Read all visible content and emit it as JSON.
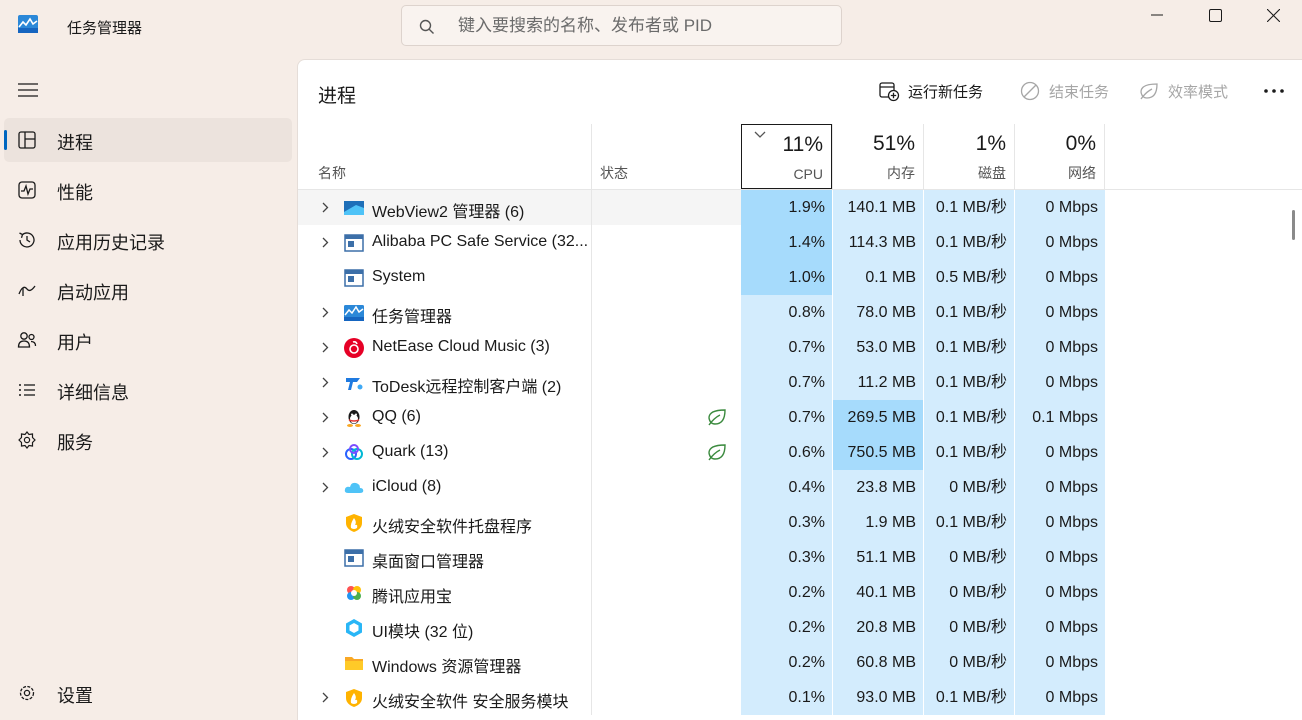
{
  "app": {
    "title": "任务管理器"
  },
  "search": {
    "placeholder": "键入要搜索的名称、发布者或 PID"
  },
  "sidebar": {
    "items": [
      {
        "label": "进程",
        "icon": "processes-icon",
        "active": true
      },
      {
        "label": "性能",
        "icon": "performance-icon"
      },
      {
        "label": "应用历史记录",
        "icon": "app-history-icon"
      },
      {
        "label": "启动应用",
        "icon": "startup-apps-icon"
      },
      {
        "label": "用户",
        "icon": "users-icon"
      },
      {
        "label": "详细信息",
        "icon": "details-icon"
      },
      {
        "label": "服务",
        "icon": "services-icon"
      }
    ],
    "settings_label": "设置"
  },
  "main": {
    "title": "进程",
    "toolbar": {
      "run_new_task": "运行新任务",
      "end_task": "结束任务",
      "efficiency_mode": "效率模式"
    }
  },
  "columns": {
    "name": "名称",
    "status": "状态",
    "cpu": {
      "pct": "11%",
      "label": "CPU"
    },
    "memory": {
      "pct": "51%",
      "label": "内存"
    },
    "disk": {
      "pct": "1%",
      "label": "磁盘"
    },
    "network": {
      "pct": "0%",
      "label": "网络"
    }
  },
  "processes": [
    {
      "name": "WebView2 管理器 (6)",
      "expandable": true,
      "icon": "webview2-icon",
      "efficiency": false,
      "cpu": "1.9%",
      "mem": "140.1 MB",
      "disk": "0.1 MB/秒",
      "net": "0 Mbps"
    },
    {
      "name": "Alibaba PC Safe Service (32...",
      "expandable": true,
      "icon": "service-window-icon",
      "efficiency": false,
      "cpu": "1.4%",
      "mem": "114.3 MB",
      "disk": "0.1 MB/秒",
      "net": "0 Mbps"
    },
    {
      "name": "System",
      "expandable": false,
      "icon": "system-window-icon",
      "efficiency": false,
      "cpu": "1.0%",
      "mem": "0.1 MB",
      "disk": "0.5 MB/秒",
      "net": "0 Mbps"
    },
    {
      "name": "任务管理器",
      "expandable": true,
      "icon": "task-manager-icon",
      "efficiency": false,
      "cpu": "0.8%",
      "mem": "78.0 MB",
      "disk": "0.1 MB/秒",
      "net": "0 Mbps"
    },
    {
      "name": "NetEase Cloud Music (3)",
      "expandable": true,
      "icon": "netease-music-icon",
      "efficiency": false,
      "cpu": "0.7%",
      "mem": "53.0 MB",
      "disk": "0.1 MB/秒",
      "net": "0 Mbps"
    },
    {
      "name": "ToDesk远程控制客户端 (2)",
      "expandable": true,
      "icon": "todesk-icon",
      "efficiency": false,
      "cpu": "0.7%",
      "mem": "11.2 MB",
      "disk": "0.1 MB/秒",
      "net": "0 Mbps"
    },
    {
      "name": "QQ (6)",
      "expandable": true,
      "icon": "qq-icon",
      "efficiency": true,
      "cpu": "0.7%",
      "mem": "269.5 MB",
      "disk": "0.1 MB/秒",
      "net": "0.1 Mbps"
    },
    {
      "name": "Quark (13)",
      "expandable": true,
      "icon": "quark-icon",
      "efficiency": true,
      "cpu": "0.6%",
      "mem": "750.5 MB",
      "disk": "0.1 MB/秒",
      "net": "0 Mbps"
    },
    {
      "name": "iCloud (8)",
      "expandable": true,
      "icon": "icloud-icon",
      "efficiency": false,
      "cpu": "0.4%",
      "mem": "23.8 MB",
      "disk": "0 MB/秒",
      "net": "0 Mbps"
    },
    {
      "name": "火绒安全软件托盘程序",
      "expandable": false,
      "icon": "huorong-icon",
      "efficiency": false,
      "cpu": "0.3%",
      "mem": "1.9 MB",
      "disk": "0.1 MB/秒",
      "net": "0 Mbps"
    },
    {
      "name": "桌面窗口管理器",
      "expandable": false,
      "icon": "dwm-window-icon",
      "efficiency": false,
      "cpu": "0.3%",
      "mem": "51.1 MB",
      "disk": "0 MB/秒",
      "net": "0 Mbps"
    },
    {
      "name": "腾讯应用宝",
      "expandable": false,
      "icon": "yingyongbao-icon",
      "efficiency": false,
      "cpu": "0.2%",
      "mem": "40.1 MB",
      "disk": "0 MB/秒",
      "net": "0 Mbps"
    },
    {
      "name": "UI模块 (32 位)",
      "expandable": false,
      "icon": "ui-module-icon",
      "efficiency": false,
      "cpu": "0.2%",
      "mem": "20.8 MB",
      "disk": "0 MB/秒",
      "net": "0 Mbps"
    },
    {
      "name": "Windows 资源管理器",
      "expandable": false,
      "icon": "explorer-folder-icon",
      "efficiency": false,
      "cpu": "0.2%",
      "mem": "60.8 MB",
      "disk": "0 MB/秒",
      "net": "0 Mbps"
    },
    {
      "name": "火绒安全软件 安全服务模块",
      "expandable": true,
      "icon": "huorong-icon",
      "efficiency": false,
      "cpu": "0.1%",
      "mem": "93.0 MB",
      "disk": "0.1 MB/秒",
      "net": "0 Mbps"
    }
  ],
  "colors": {
    "accent": "#0067c0",
    "heat_light": "#d3ecfd",
    "heat_medium": "#a6dbfc",
    "heat_strong": "#94d2fa",
    "efficiency_green": "#3b8a3e"
  }
}
